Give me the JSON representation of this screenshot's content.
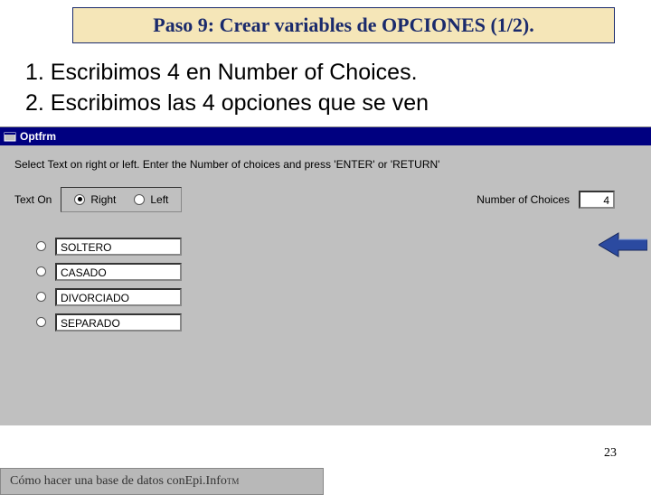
{
  "slide": {
    "title": "Paso 9: Crear variables de OPCIONES (1/2).",
    "step1": "1. Escribimos 4 en Number of Choices.",
    "step2": "2. Escribimos las 4 opciones que se ven",
    "page_number": "23",
    "footer_prefix": "Cómo hacer una base de datos con ",
    "footer_app": "Epi.Info",
    "footer_tm": "TM"
  },
  "window": {
    "title": "Optfrm",
    "instruction": "Select Text on right or left. Enter the Number of choices and press  'ENTER' or 'RETURN'",
    "text_on_label": "Text  On",
    "radio_right": "Right",
    "radio_left": "Left",
    "num_choices_label": "Number of Choices",
    "num_choices_value": "4",
    "choices": [
      "SOLTERO",
      "CASADO",
      "DIVORCIADO",
      "SEPARADO"
    ]
  }
}
